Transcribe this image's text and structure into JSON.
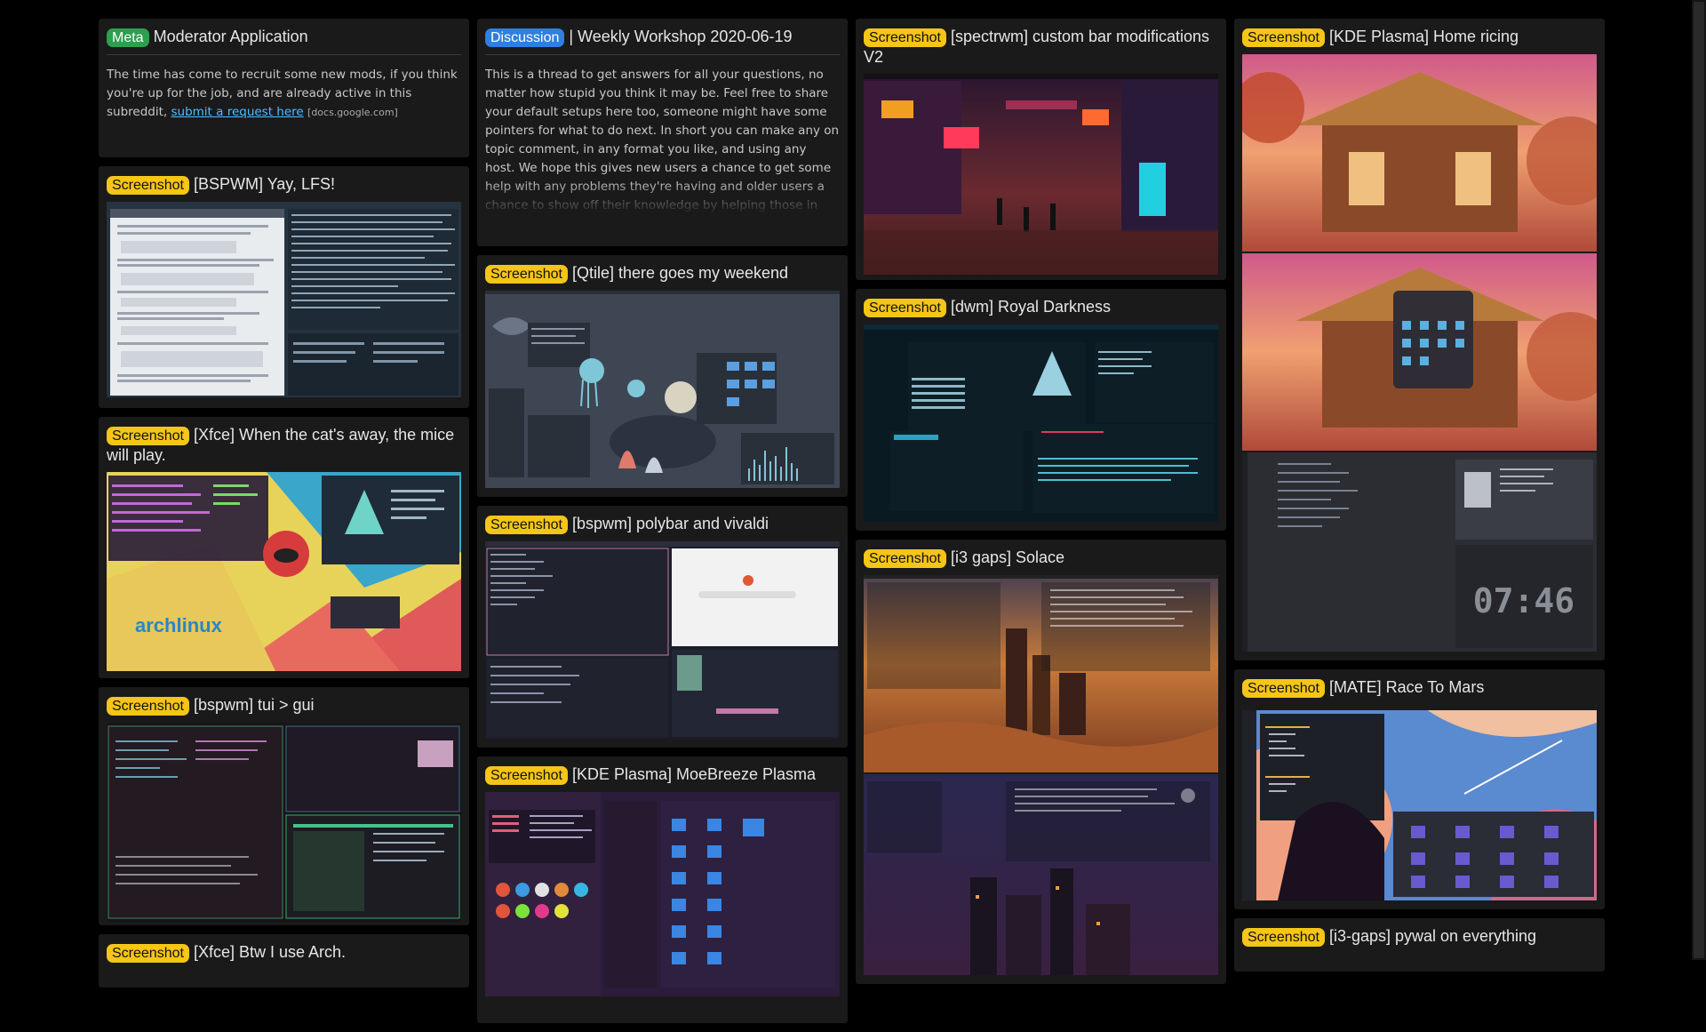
{
  "colors": {
    "page_bg": "#000000",
    "card_bg": "#1a1a1b",
    "flair_screenshot": "#f5c518",
    "flair_meta": "#2e9e4f",
    "flair_discussion": "#2f7fe0",
    "link": "#4fbcff"
  },
  "flairs": {
    "screenshot": "Screenshot",
    "meta": "Meta",
    "discussion": "Discussion"
  },
  "posts": {
    "mod_app": {
      "title": "Moderator Application",
      "body": "The time has come to recruit some new mods, if you think you're up for the job, and are already active in this subreddit, ",
      "link_text": "submit a request here",
      "domain": "[docs.google.com]"
    },
    "workshop": {
      "title": "| Weekly Workshop 2020-06-19",
      "body": "This is a thread to get answers for all your questions, no matter how stupid you think it may be. Feel free to share your default setups here too, someone might have some pointers for what to do next. In short you can make any on topic comment, in any format you like, and using any host. We hope this gives new users a chance to get some help with any problems they're having and older users a chance to show off their knowledge by helping those in need."
    },
    "bspwm_lfs": {
      "title": "[BSPWM] Yay, LFS!"
    },
    "xfce_cat": {
      "title": "[Xfce] When the cat's away, the mice will play."
    },
    "bspwm_tui": {
      "title": "[bspwm] tui > gui"
    },
    "xfce_btw": {
      "title": "[Xfce] Btw I use Arch."
    },
    "qtile": {
      "title": "[Qtile] there goes my weekend"
    },
    "polybar": {
      "title": "[bspwm] polybar and vivaldi"
    },
    "moebreeze": {
      "title": "[KDE Plasma] MoeBreeze Plasma"
    },
    "spectrwm": {
      "title": "[spectrwm] custom bar modifications V2"
    },
    "dwm": {
      "title": "[dwm] Royal Darkness"
    },
    "i3_solace": {
      "title": "[i3 gaps] Solace"
    },
    "kde_home": {
      "title": "[KDE Plasma] Home ricing",
      "clock": "07:46"
    },
    "mate": {
      "title": "[MATE] Race To Mars"
    },
    "i3_pywal": {
      "title": "[i3-gaps] pywal on everything"
    }
  },
  "thumb_text": {
    "archlinux": "archlinux"
  }
}
